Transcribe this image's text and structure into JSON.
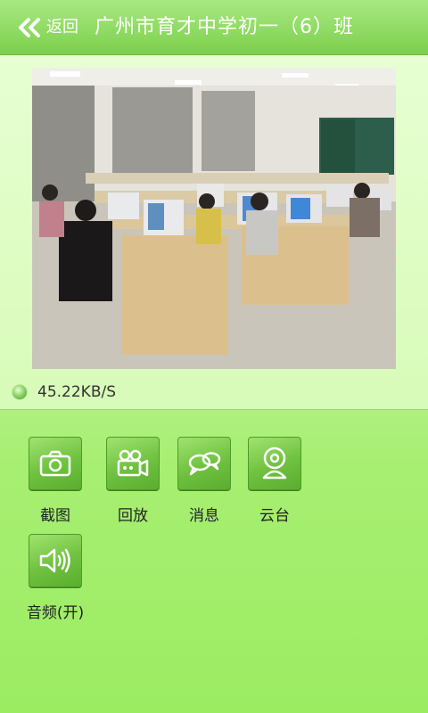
{
  "header": {
    "back_label": "返回",
    "title": "广州市育才中学初一（6）班"
  },
  "video": {
    "speed": "45.22KB/S"
  },
  "controls": [
    {
      "label": "截图",
      "icon": "camera-icon"
    },
    {
      "label": "回放",
      "icon": "video-camera-icon"
    },
    {
      "label": "消息",
      "icon": "chat-bubbles-icon"
    },
    {
      "label": "云台",
      "icon": "webcam-icon"
    },
    {
      "label": "音频(开)",
      "icon": "speaker-icon"
    }
  ],
  "colors": {
    "header": "#7ccf4c",
    "button": "#6fc13f",
    "background": "#b4f184"
  }
}
